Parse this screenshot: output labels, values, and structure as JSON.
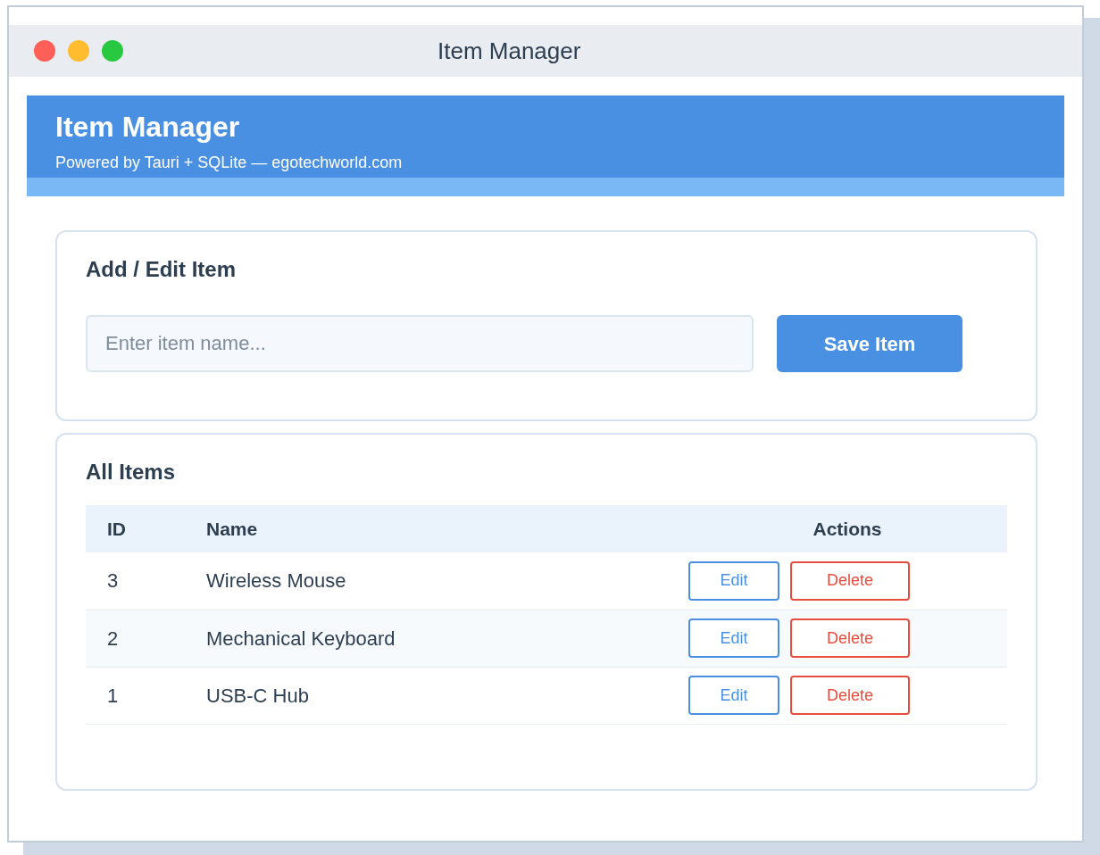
{
  "window": {
    "title": "Item Manager"
  },
  "header": {
    "title": "Item Manager",
    "subtitle": "Powered by Tauri + SQLite — egotechworld.com"
  },
  "form": {
    "heading": "Add / Edit Item",
    "input": {
      "placeholder": "Enter item name..."
    },
    "button": "Save Item"
  },
  "table": {
    "heading": "All Items",
    "columns": [
      "ID",
      "Name",
      "Actions"
    ],
    "rows": [
      {
        "id": "3",
        "name": "Wireless Mouse",
        "actions": [
          "Edit",
          "Delete"
        ]
      },
      {
        "id": "2",
        "name": "Mechanical Keyboard",
        "actions": [
          "Edit",
          "Delete"
        ]
      },
      {
        "id": "1",
        "name": "USB-C Hub",
        "actions": [
          "Edit",
          "Delete"
        ]
      }
    ]
  }
}
